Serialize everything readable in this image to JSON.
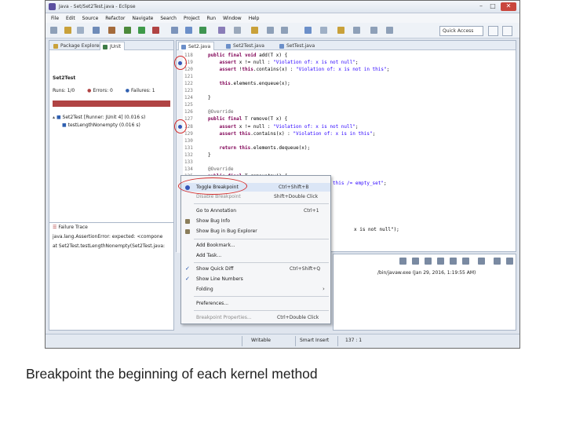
{
  "window": {
    "title": "Java - Set/Set2Test.java - Eclipse",
    "controls": {
      "minimize": "–",
      "maximize": "□",
      "close": "✕"
    }
  },
  "menubar": [
    "File",
    "Edit",
    "Source",
    "Refactor",
    "Navigate",
    "Search",
    "Project",
    "Run",
    "Window",
    "Help"
  ],
  "toolbar": {
    "quick_access": "Quick Access"
  },
  "left_panel": {
    "tabs": [
      {
        "label": "Package Explorer",
        "icon": "package-icon"
      },
      {
        "label": "JUnit",
        "icon": "junit-icon"
      }
    ],
    "test_class": "Set2Test",
    "runs_label": "Runs:",
    "runs_value": "1/0",
    "errors_label": "Errors:",
    "errors_value": "0",
    "failures_label": "Failures:",
    "failures_value": "1",
    "tree": [
      "Set2Test [Runner: JUnit 4] (0.016 s)",
      "testLengthNonempty (0.016 s)"
    ],
    "failure_trace_title": "Failure Trace",
    "trace_lines": [
      "java.lang.AssertionError: expected: <compone",
      "at Set2Test.testLengthNonempty(Set2Test.java:"
    ]
  },
  "editor": {
    "tabs": [
      "Set2.java",
      "Set2Test.java",
      "SetTest.java"
    ],
    "lines": [
      {
        "n": "118",
        "code": "public final void add(T x) {"
      },
      {
        "n": "119",
        "code": "    assert x != null : \"Violation of: x is not null\";"
      },
      {
        "n": "120",
        "code": "    assert !this.contains(x) : \"Violation of: x is not in this\";"
      },
      {
        "n": "121",
        "code": ""
      },
      {
        "n": "122",
        "code": "    this.elements.enqueue(x);"
      },
      {
        "n": "123",
        "code": ""
      },
      {
        "n": "124",
        "code": "}"
      },
      {
        "n": "125",
        "code": ""
      },
      {
        "n": "126",
        "code": "@Override"
      },
      {
        "n": "127",
        "code": "public final T remove(T x) {"
      },
      {
        "n": "128",
        "code": "    assert x != null : \"Violation of: x is not null\";"
      },
      {
        "n": "129",
        "code": "    assert this.contains(x) : \"Violation of: x is in this\";"
      },
      {
        "n": "130",
        "code": ""
      },
      {
        "n": "131",
        "code": "    return this.elements.dequeue(x);"
      },
      {
        "n": "132",
        "code": "}"
      },
      {
        "n": "133",
        "code": ""
      },
      {
        "n": "134",
        "code": "@Override"
      },
      {
        "n": "135",
        "code": "public final T removeAny() {"
      },
      {
        "n": "136",
        "code": "    assert this.size() > 0 : \"Violation of: this /= empty_set\";"
      }
    ],
    "after_menu_line": "x is not null\");"
  },
  "context_menu": {
    "items": [
      {
        "label": "Toggle Breakpoint",
        "shortcut": "Ctrl+Shift+B",
        "icon": "breakpoint-icon"
      },
      {
        "label": "Disable Breakpoint",
        "shortcut": "Shift+Double Click"
      },
      {
        "label": "Go to Annotation",
        "shortcut": "Ctrl+1"
      },
      {
        "label": "Show Bug Info",
        "icon": "bug-icon"
      },
      {
        "label": "Show Bug in Bug Explorer",
        "icon": "bug-icon"
      },
      {
        "label": "Add Bookmark..."
      },
      {
        "label": "Add Task..."
      },
      {
        "label": "Show Quick Diff",
        "shortcut": "Ctrl+Shift+Q",
        "check": "✓"
      },
      {
        "label": "Show Line Numbers",
        "check": "✓"
      },
      {
        "label": "Folding",
        "submenu": "›"
      },
      {
        "label": "Preferences..."
      },
      {
        "label": "Breakpoint Properties...",
        "shortcut": "Ctrl+Double Click"
      }
    ]
  },
  "console": {
    "launch_text": "/bin/javaw.exe (Jan 29, 2016, 1:19:55 AM)"
  },
  "statusbar": {
    "mode": "Writable",
    "insert": "Smart Insert",
    "position": "137 : 1"
  },
  "caption": "Breakpoint the beginning of each kernel method",
  "colors": {
    "accent": "#d42a2a",
    "junit_failure": "#b04343",
    "keyword": "#7f0055",
    "string": "#2a00ff"
  }
}
